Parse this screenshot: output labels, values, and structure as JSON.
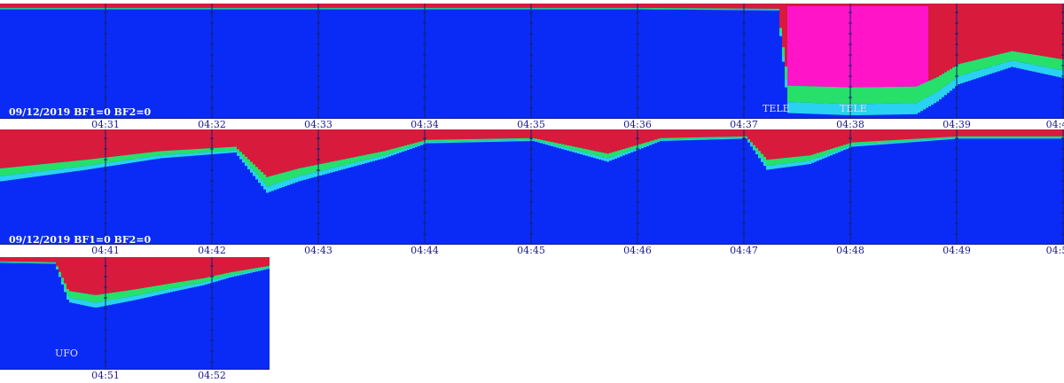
{
  "chart_data": {
    "type": "heatmap",
    "colors": {
      "low": "#0a2bf5",
      "mid": "#28d2f0",
      "green": "#26e06a",
      "high": "#d81a3c",
      "peak": "#ff14c8",
      "axis": "#1a1a8c",
      "gridline": "#14206e"
    },
    "rows": [
      {
        "date_label": "09/12/2019 BF1=0 BF2=0",
        "tick_labels": [
          "04:31",
          "04:32",
          "04:33",
          "04:34",
          "04:35",
          "04:36",
          "04:37",
          "04:38",
          "04:39",
          "04:4"
        ],
        "annotations": [
          "TELE",
          "TELE"
        ],
        "profile": [
          [
            0,
            0.05
          ],
          [
            0.2,
            0.05
          ],
          [
            0.4,
            0.05
          ],
          [
            0.6,
            0.05
          ],
          [
            0.73,
            0.06
          ],
          [
            0.74,
            0.95
          ],
          [
            0.8,
            0.97
          ],
          [
            0.86,
            0.96
          ],
          [
            0.88,
            0.85
          ],
          [
            0.9,
            0.7
          ],
          [
            0.95,
            0.55
          ],
          [
            1.0,
            0.65
          ]
        ]
      },
      {
        "date_label": "09/12/2019 BF1=0 BF2=0",
        "tick_labels": [
          "04:41",
          "04:42",
          "04:43",
          "04:44",
          "04:45",
          "04:46",
          "04:47",
          "04:48",
          "04:49",
          "04:5"
        ],
        "annotations": [],
        "profile": [
          [
            0,
            0.45
          ],
          [
            0.08,
            0.35
          ],
          [
            0.15,
            0.25
          ],
          [
            0.22,
            0.2
          ],
          [
            0.25,
            0.55
          ],
          [
            0.28,
            0.45
          ],
          [
            0.32,
            0.35
          ],
          [
            0.36,
            0.25
          ],
          [
            0.4,
            0.12
          ],
          [
            0.5,
            0.1
          ],
          [
            0.57,
            0.28
          ],
          [
            0.62,
            0.1
          ],
          [
            0.7,
            0.08
          ],
          [
            0.72,
            0.35
          ],
          [
            0.76,
            0.3
          ],
          [
            0.8,
            0.15
          ],
          [
            0.9,
            0.08
          ],
          [
            1.0,
            0.08
          ]
        ]
      },
      {
        "date_label": "",
        "tick_labels": [
          "04:51",
          "04:52"
        ],
        "annotations": [
          "UFO"
        ],
        "profile": [
          [
            0,
            0.05
          ],
          [
            0.2,
            0.06
          ],
          [
            0.25,
            0.4
          ],
          [
            0.35,
            0.45
          ],
          [
            0.5,
            0.38
          ],
          [
            0.65,
            0.3
          ],
          [
            0.75,
            0.25
          ],
          [
            0.85,
            0.18
          ],
          [
            1.0,
            0.1
          ]
        ]
      }
    ]
  }
}
